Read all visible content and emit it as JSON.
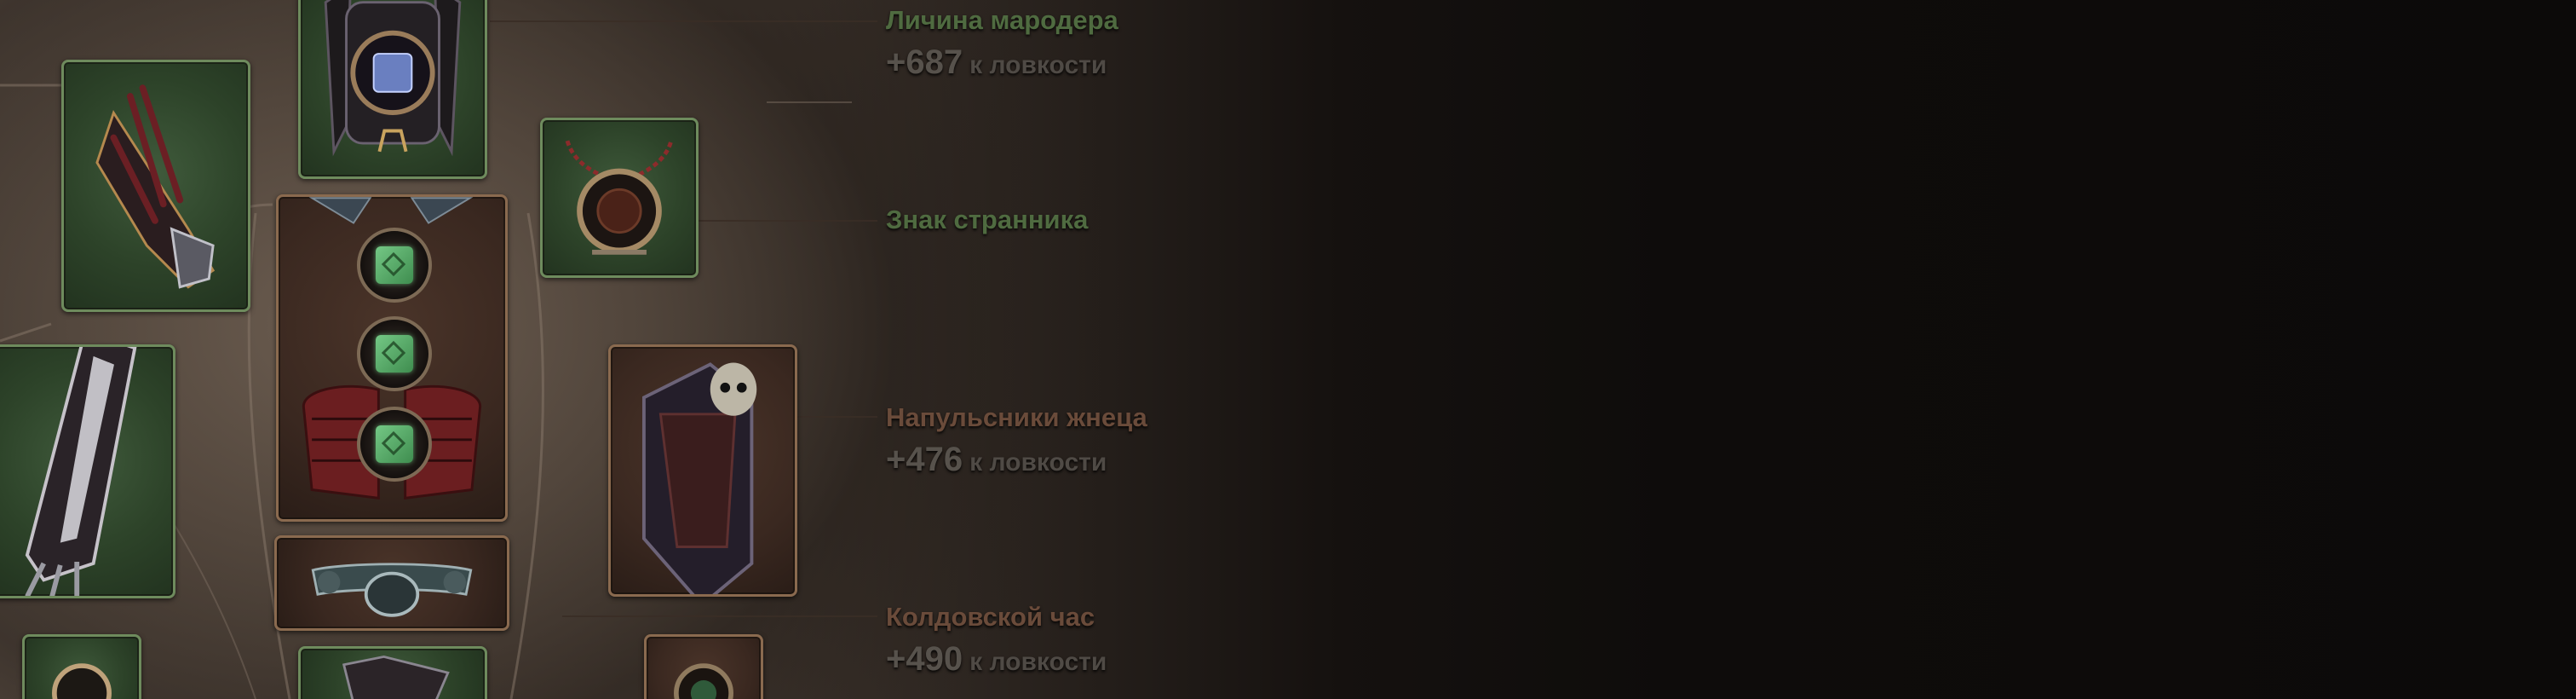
{
  "items": [
    {
      "name": "Личина мародера",
      "color": "#4f6b40",
      "stat_value": "+687",
      "stat_suffix": "к ловкости"
    },
    {
      "name": "Знак странника",
      "color": "#4f6b40",
      "stat_value": "",
      "stat_suffix": ""
    },
    {
      "name": "Напульсники жнеца",
      "color": "#6a4b3a",
      "stat_value": "+476",
      "stat_suffix": "к ловкости"
    },
    {
      "name": "Колдовской час",
      "color": "#6a4b3a",
      "stat_value": "+490",
      "stat_suffix": "к ловкости"
    }
  ],
  "colors": {
    "set_item_green": "#4f6b40",
    "legendary_brown": "#6a4b3a",
    "stat_gray": "#57524c"
  },
  "slots": [
    {
      "name": "helm",
      "frame": "green",
      "icon": "helm-icon"
    },
    {
      "name": "gloves",
      "frame": "green",
      "icon": "gloves-icon"
    },
    {
      "name": "amulet",
      "frame": "green",
      "icon": "amulet-icon"
    },
    {
      "name": "chest",
      "frame": "brown",
      "icon": "chest-armor-icon"
    },
    {
      "name": "bracers",
      "frame": "green",
      "icon": "bracers-icon"
    },
    {
      "name": "offhand",
      "frame": "brown",
      "icon": "cloak-shield-icon"
    },
    {
      "name": "belt",
      "frame": "brown",
      "icon": "belt-icon"
    }
  ]
}
